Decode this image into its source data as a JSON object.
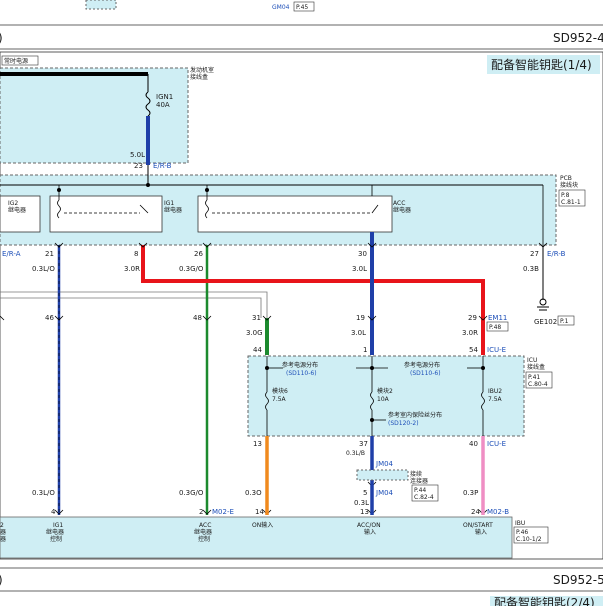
{
  "page_top": {
    "ref_code": "GM04",
    "ref_page": "P.45"
  },
  "header1": {
    "left": ")",
    "code": "SD952-4",
    "title": "配备智能钥匙(1/4)"
  },
  "footer": {
    "left": ")",
    "code": "SD952-5",
    "next_title": "配备智能钥匙(2/4)"
  },
  "power": {
    "label": "常时电源"
  },
  "engine_box": {
    "line1": "发动机室",
    "line2": "接线盒"
  },
  "fuse_ign1": {
    "name": "IGN1",
    "rating": "40A"
  },
  "wire_main": {
    "size": "5.0L",
    "pin": "23",
    "code": "E/R-B"
  },
  "pcb": {
    "line1": "PCB",
    "line2": "接线块",
    "ref1": "P.8",
    "ref2": "C.81-1"
  },
  "relay_ig2": {
    "line1": "IG2",
    "line2": "继电器"
  },
  "relay_ig1": {
    "line1": "IG1",
    "line2": "继电器"
  },
  "relay_acc": {
    "line1": "ACC",
    "line2": "继电器"
  },
  "left_conn": {
    "code": "E/R-A"
  },
  "right_conn": {
    "code": "E/R-B"
  },
  "pins_top": [
    {
      "pin": "21",
      "wire": "0.3L/O"
    },
    {
      "pin": "8",
      "wire": "3.0R"
    },
    {
      "pin": "26",
      "wire": "0.3G/O"
    },
    {
      "pin": "30",
      "wire": "3.0L"
    },
    {
      "pin": "27",
      "wire": "0.3B"
    }
  ],
  "ground": {
    "name": "GE102",
    "ref": "P.1"
  },
  "pins_mid": [
    {
      "pin": "46"
    },
    {
      "pin": "48"
    },
    {
      "pin": "31",
      "wire": "3.0G"
    },
    {
      "pin": "19",
      "wire": "3.0L"
    },
    {
      "pin": "29",
      "wire": "3.0R"
    }
  ],
  "em11": {
    "code": "EM11",
    "ref": "P.48"
  },
  "icu": {
    "line1": "ICU",
    "line2": "接线盒",
    "ref1": "P.41",
    "ref2": "C.80-4",
    "conn": "ICU-E"
  },
  "icu_pins_in": [
    {
      "pin": "44"
    },
    {
      "pin": "1"
    },
    {
      "pin": "54"
    }
  ],
  "icu_refs": [
    {
      "text": "参考电源分布",
      "ref": "(SD110-6)"
    },
    {
      "text": "参考电源分布",
      "ref": "(SD110-6)"
    },
    {
      "text": "参考室内保险丝分布",
      "ref": "(SD120-2)"
    }
  ],
  "fuses": [
    {
      "name": "模块6",
      "rating": "7.5A"
    },
    {
      "name": "模块2",
      "rating": "10A"
    },
    {
      "name": "IBU2",
      "rating": "7.5A"
    }
  ],
  "icu_pins_out": [
    {
      "pin": "13"
    },
    {
      "pin": "37"
    },
    {
      "pin": "40"
    }
  ],
  "icu_out_conn": "ICU-E",
  "jm04": {
    "code": "JM04",
    "wire_in": "0.3L/B",
    "wire_out": "0.3L",
    "pin": "5",
    "label1": "接续",
    "label2": "连接器",
    "ref1": "P.44",
    "ref2": "C.82-4"
  },
  "bottom_wires": [
    {
      "wire": "0.3L/O",
      "pin": "4"
    },
    {
      "wire": "0.3G/O",
      "pin": "2"
    },
    {
      "wire": "0.3O",
      "pin": "14"
    },
    {
      "wire": "",
      "pin": "13"
    },
    {
      "wire": "0.3P",
      "pin": "24"
    }
  ],
  "m02e": "M02-E",
  "m02b": "M02-B",
  "ibu": {
    "name": "IBU",
    "ref1": "P.46",
    "ref2": "C.10-1/2",
    "labels": [
      {
        "l1": "2",
        "l2": "器",
        "l3": "器"
      },
      {
        "l1": "IG1",
        "l2": "继电器",
        "l3": "控制"
      },
      {
        "l1": "ACC",
        "l2": "继电器",
        "l3": "控制"
      },
      {
        "l1": "ON输入",
        "l2": "",
        "l3": ""
      },
      {
        "l1": "ACC/ON",
        "l2": "输入",
        "l3": ""
      },
      {
        "l1": "ON/START",
        "l2": "输入",
        "l3": ""
      }
    ]
  },
  "colors": {
    "blue": "#1f3fa8",
    "red": "#e8141a",
    "green": "#1c8a2e",
    "orange": "#f08a1e",
    "pink": "#ef8ec4",
    "panel": "#cfeef4",
    "border": "#666666"
  }
}
